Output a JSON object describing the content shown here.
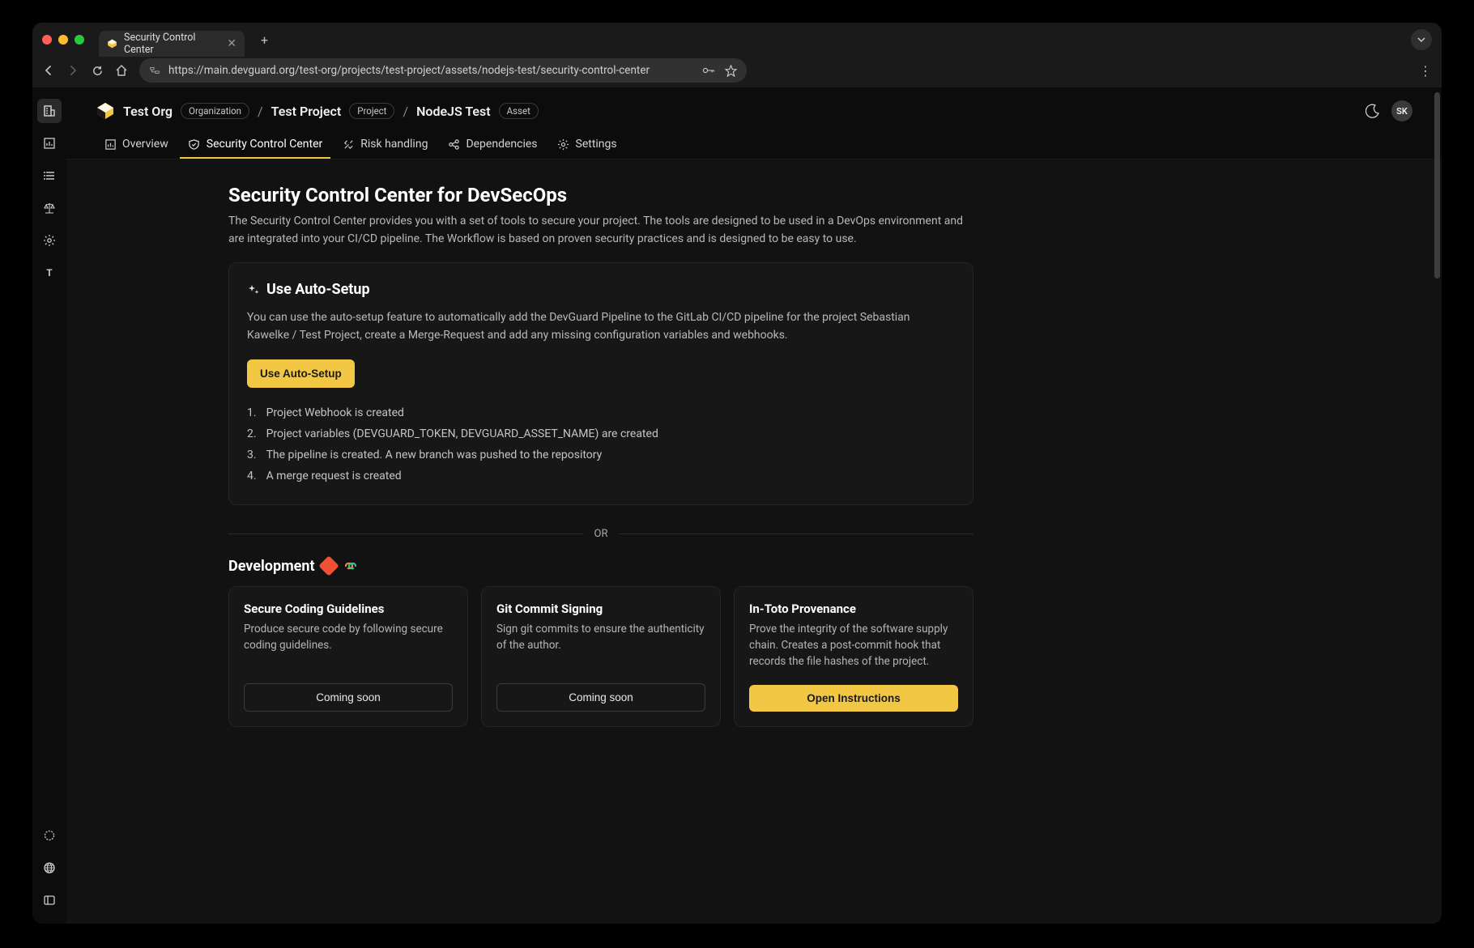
{
  "browser": {
    "tab_title": "Security Control Center",
    "url": "https://main.devguard.org/test-org/projects/test-project/assets/nodejs-test/security-control-center"
  },
  "sidebar": {
    "org_letter": "T"
  },
  "breadcrumbs": {
    "org_name": "Test Org",
    "org_pill": "Organization",
    "project_name": "Test Project",
    "project_pill": "Project",
    "asset_name": "NodeJS Test",
    "asset_pill": "Asset",
    "avatar": "SK"
  },
  "tabs": {
    "overview": "Overview",
    "security": "Security Control Center",
    "risk": "Risk handling",
    "deps": "Dependencies",
    "settings": "Settings"
  },
  "page": {
    "title": "Security Control Center for DevSecOps",
    "description": "The Security Control Center provides you with a set of tools to secure your project. The tools are designed to be used in a DevOps environment and are integrated into your CI/CD pipe­line. The Workflow is based on proven security practices and is designed to be easy to use."
  },
  "auto_setup": {
    "title": "Use Auto-Setup",
    "description": "You can use the auto-setup feature to automatically add the DevGuard Pipeline to the GitLab CI/CD pipeline for the project Sebastian Kawelke / Test Project, create a Merge-Re­quest and add any missing configuration variables and webhooks.",
    "button": "Use Auto-Setup",
    "steps": [
      "Project Webhook is created",
      "Project variables (DEVGUARD_TOKEN, DEVGUARD_ASSET_NAME) are created",
      "The pipeline is created. A new branch was pushed to the repository",
      "A merge request is created"
    ]
  },
  "divider": {
    "or": "OR"
  },
  "dev_section": {
    "title": "Development",
    "cards": [
      {
        "title": "Secure Coding Guidelines",
        "desc": "Produce secure code by following secure coding guidelines.",
        "button": "Coming soon",
        "button_kind": "outline"
      },
      {
        "title": "Git Commit Signing",
        "desc": "Sign git commits to ensure the authenticity of the author.",
        "button": "Coming soon",
        "button_kind": "outline"
      },
      {
        "title": "In-Toto Provenance",
        "desc": "Prove the integrity of the software supply chain. Creates a post-commit hook that records the file hashes of the project.",
        "button": "Open Instructions",
        "button_kind": "primary"
      }
    ]
  }
}
